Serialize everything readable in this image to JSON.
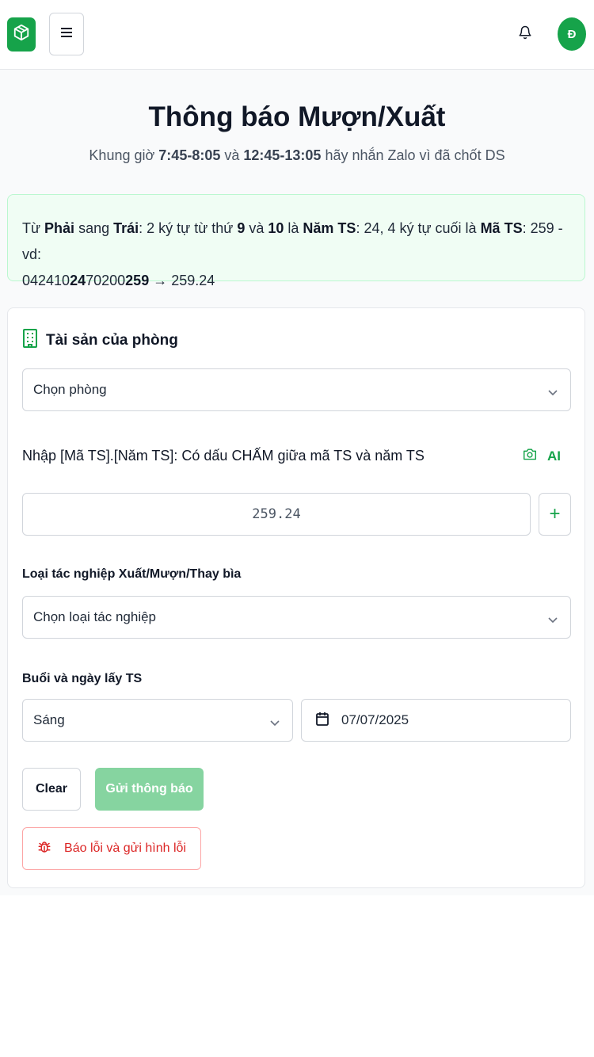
{
  "header": {
    "logo_icon": "package-icon",
    "menu_icon": "hamburger-icon",
    "bell_icon": "bell-icon",
    "avatar_initial": "Đ",
    "brand_color": "#16a34a"
  },
  "page": {
    "title": "Thông báo Mượn/Xuất",
    "subtitle_parts": [
      "Khung giờ ",
      "7:45-8:05",
      " và ",
      "12:45-13:05",
      " hãy nhắn Zalo vì đã chốt DS"
    ]
  },
  "info": {
    "parts": [
      "Từ ",
      "Phải",
      " sang ",
      "Trái",
      ": 2 ký tự từ thứ ",
      "9",
      " và ",
      "10",
      " là ",
      "Năm TS",
      ": 24, 4 ký tự cuối là ",
      "Mã TS",
      ": 259 - vd: "
    ],
    "example_parts": [
      "042410",
      "24",
      "70200",
      "259",
      " → 259.24"
    ]
  },
  "form": {
    "section_title": "Tài sản của phòng",
    "room_select": {
      "value": "Chọn phòng"
    },
    "ts_label": "Nhập [Mã TS].[Năm TS]: Có dấu CHẤM giữa mã TS và năm TS",
    "ai_label": "AI",
    "ts_input": {
      "value": "259.24"
    },
    "plus_label": "+",
    "op_label": "Loại tác nghiệp Xuất/Mượn/Thay bìa",
    "op_select": {
      "value": "Chọn loại tác nghiệp"
    },
    "time_label": "Buổi và ngày lấy TS",
    "session_select": {
      "value": "Sáng"
    },
    "date_value": "07/07/2025",
    "clear_label": "Clear",
    "send_label": "Gửi thông báo",
    "report_label": "Báo lỗi và gửi hình lỗi"
  }
}
